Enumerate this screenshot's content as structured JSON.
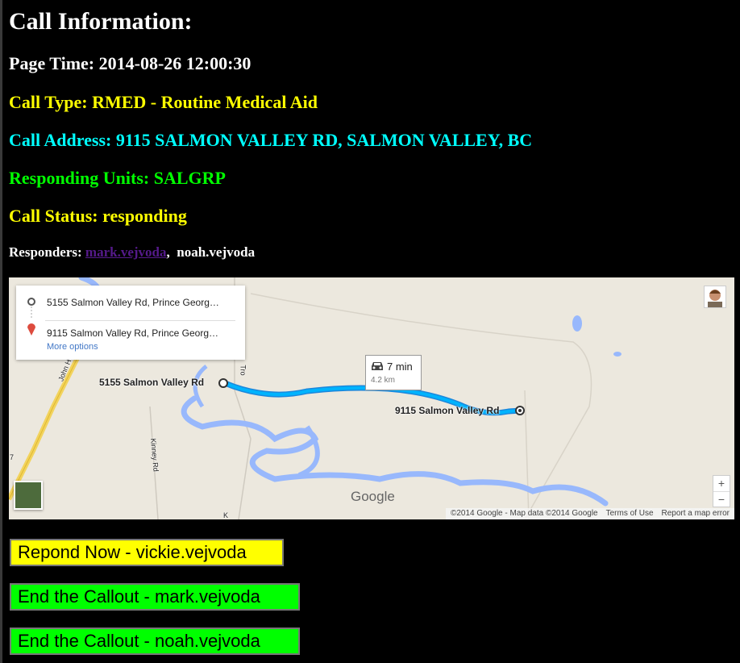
{
  "title": "Call Information:",
  "page_time": "Page Time: 2014-08-26 12:00:30",
  "call_type": "Call Type: RMED - Routine Medical Aid",
  "call_address": "Call Address: 9115 SALMON VALLEY RD, SALMON VALLEY, BC",
  "responding_units": "Responding Units: SALGRP",
  "call_status": "Call Status: responding",
  "responders": {
    "label": "Responders:",
    "items": [
      "mark.vejvoda",
      "noah.vejvoda"
    ]
  },
  "map": {
    "origin": "5155 Salmon Valley Rd, Prince Georg…",
    "destination": "9115 Salmon Valley Rd, Prince Georg…",
    "more_options": "More options",
    "travel_time": "7 min",
    "distance": "4.2 km",
    "origin_label": "5155 Salmon Valley Rd",
    "destination_label": "9115 Salmon Valley Rd",
    "road_labels": [
      "John H",
      "Kinney Rd",
      "Tro",
      "7",
      "K"
    ],
    "logo": "Google",
    "copyright": "©2014 Google - Map data ©2014 Google",
    "terms": "Terms of Use",
    "report": "Report a map error",
    "zoom_in": "+",
    "zoom_out": "−",
    "colors": {
      "route": "#00b3fd",
      "water": "#98b8fc",
      "land": "#ece8de"
    }
  },
  "buttons": {
    "respond": "Repond Now - vickie.vejvoda",
    "end_mark": "End the Callout - mark.vejvoda",
    "end_noah": "End the Callout - noah.vejvoda"
  }
}
